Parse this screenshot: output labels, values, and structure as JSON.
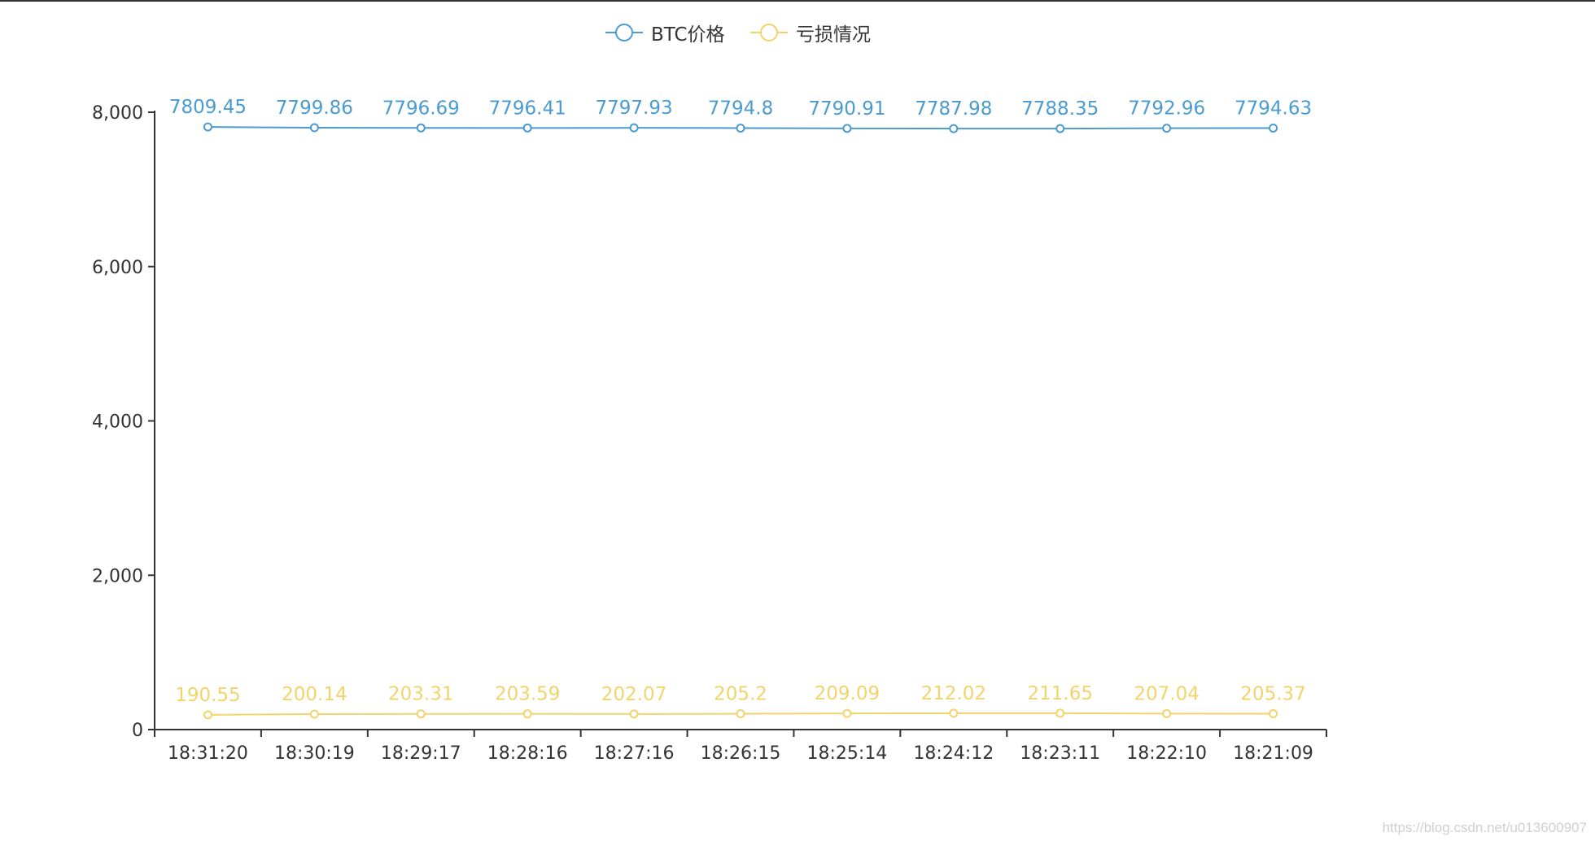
{
  "chart_data": {
    "type": "line",
    "categories": [
      "18:31:20",
      "18:30:19",
      "18:29:17",
      "18:28:16",
      "18:27:16",
      "18:26:15",
      "18:25:14",
      "18:24:12",
      "18:23:11",
      "18:22:10",
      "18:21:09"
    ],
    "series": [
      {
        "name": "BTC价格",
        "color": "#4a9bd2",
        "values": [
          7809.45,
          7799.86,
          7796.69,
          7796.41,
          7797.93,
          7794.8,
          7790.91,
          7787.98,
          7788.35,
          7792.96,
          7794.63
        ],
        "labels": [
          "7809.45",
          "7799.86",
          "7796.69",
          "7796.41",
          "7797.93",
          "7794.8",
          "7790.91",
          "7787.98",
          "7788.35",
          "7792.96",
          "7794.63"
        ]
      },
      {
        "name": "亏损情况",
        "color": "#f3d36b",
        "values": [
          190.55,
          200.14,
          203.31,
          203.59,
          202.07,
          205.2,
          209.09,
          212.02,
          211.65,
          207.04,
          205.37
        ],
        "labels": [
          "190.55",
          "200.14",
          "203.31",
          "203.59",
          "202.07",
          "205.2",
          "209.09",
          "212.02",
          "211.65",
          "207.04",
          "205.37"
        ]
      }
    ],
    "ylim": [
      0,
      8000
    ],
    "yticks": [
      0,
      2000,
      4000,
      6000,
      8000
    ],
    "ytick_labels": [
      "0",
      "2,000",
      "4,000",
      "6,000",
      "8,000"
    ],
    "grid": false,
    "legend": "top-center"
  },
  "watermark": "https://blog.csdn.net/u013600907"
}
